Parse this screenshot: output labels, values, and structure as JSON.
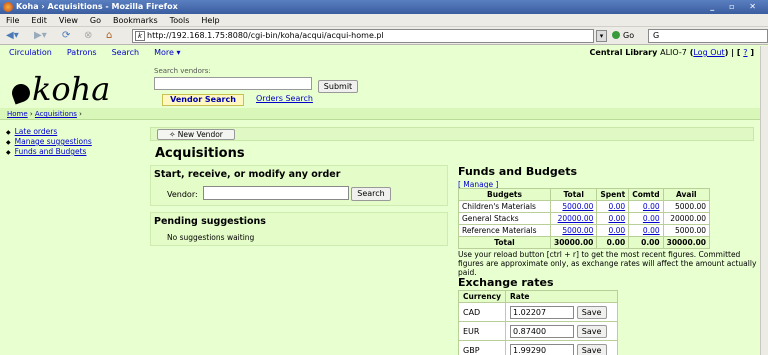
{
  "browser": {
    "window_title": "Koha › Acquisitions - Mozilla Firefox",
    "menu": [
      "File",
      "Edit",
      "View",
      "Go",
      "Bookmarks",
      "Tools",
      "Help"
    ],
    "url": "http://192.168.1.75:8080/cgi-bin/koha/acqui/acqui-home.pl",
    "go_label": "Go",
    "search_value": "G"
  },
  "koha_nav": {
    "links": [
      "Circulation",
      "Patrons",
      "Search",
      "More ▾"
    ],
    "branch": "Central Library",
    "user": "ALIO-7",
    "logout": "Log Out",
    "help": "?"
  },
  "logo_text": "koha",
  "vendor_search": {
    "placeholder_label": "Search vendors:",
    "submit_label": "Submit",
    "tab_active": "Vendor Search",
    "tab_other": "Orders Search"
  },
  "breadcrumb": {
    "home": "Home",
    "section": "Acquisitions"
  },
  "sidebar": [
    "Late orders",
    "Manage suggestions",
    "Funds and Budgets"
  ],
  "toolbar": {
    "new_vendor": "New Vendor"
  },
  "page_title": "Acquisitions",
  "start_panel": {
    "title": "Start, receive, or modify any order",
    "vendor_label": "Vendor:",
    "search_label": "Search"
  },
  "pending_panel": {
    "title": "Pending suggestions",
    "message": "No suggestions waiting"
  },
  "funds": {
    "title": "Funds and Budgets",
    "manage": "[ Manage ]",
    "headers": [
      "Budgets",
      "Total",
      "Spent",
      "Comtd",
      "Avail"
    ],
    "rows": [
      [
        "Children's Materials",
        "5000.00",
        "0.00",
        "0.00",
        "5000.00"
      ],
      [
        "General Stacks",
        "20000.00",
        "0.00",
        "0.00",
        "20000.00"
      ],
      [
        "Reference Materials",
        "5000.00",
        "0.00",
        "0.00",
        "5000.00"
      ]
    ],
    "total": [
      "Total",
      "30000.00",
      "0.00",
      "0.00",
      "30000.00"
    ],
    "note": "Use your reload button [ctrl + r] to get the most recent figures. Committed figures are approximate only, as exchange rates will affect the amount actually paid."
  },
  "exchange": {
    "title": "Exchange rates",
    "headers": [
      "Currency",
      "Rate"
    ],
    "save_label": "Save",
    "rows": [
      {
        "currency": "CAD",
        "rate": "1.02207"
      },
      {
        "currency": "EUR",
        "rate": "0.87400"
      },
      {
        "currency": "GBP",
        "rate": "1.99290"
      }
    ]
  }
}
